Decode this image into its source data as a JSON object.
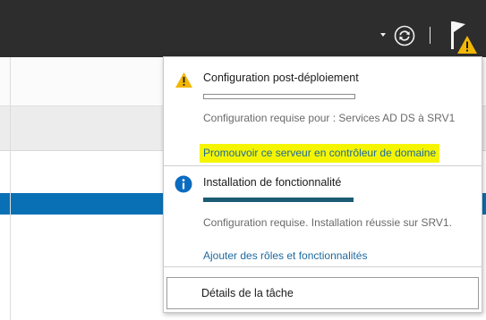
{
  "header": {
    "icons": [
      "chevron-down-icon",
      "refresh-icon",
      "flag-icon",
      "warning-icon"
    ]
  },
  "notifications": [
    {
      "icon": "warning-icon",
      "title": "Configuration post-déploiement",
      "progress": 0,
      "status": "Configuration requise pour : Services AD DS à SRV1",
      "link": "Promouvoir ce serveur en contrôleur de domaine"
    },
    {
      "icon": "info-icon",
      "title": "Installation de fonctionnalité",
      "progress": 1.0,
      "status": "Configuration requise. Installation réussie sur SRV1.",
      "link": "Ajouter des rôles et fonctionnalités"
    }
  ],
  "footer": {
    "task_details_label": "Détails de la tâche"
  },
  "colors": {
    "title_bar": "#2d2d2d",
    "highlight": "#f5f500",
    "link": "#1e6aa0",
    "progress_fill": "#1b5b73",
    "warning": "#f2b705",
    "info": "#0b6cbf",
    "selected_row": "#0a70b5"
  }
}
